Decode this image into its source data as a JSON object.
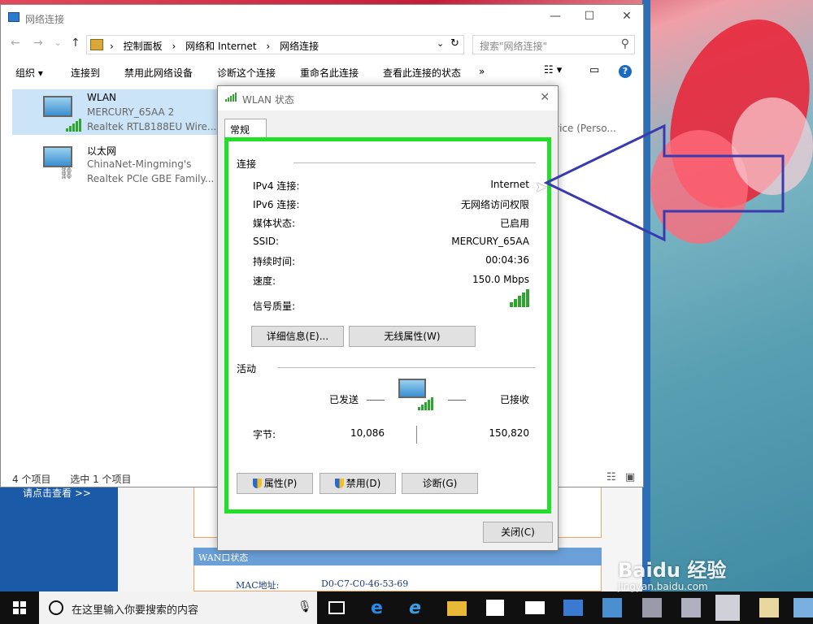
{
  "explorer": {
    "title": "网络连接",
    "breadcrumb": [
      "控制面板",
      "网络和 Internet",
      "网络连接"
    ],
    "search_placeholder": "搜索\"网络连接\"",
    "toolbar": {
      "organize": "组织 ▾",
      "connect_to": "连接到",
      "disable_device": "禁用此网络设备",
      "diagnose": "诊断这个连接",
      "rename": "重命名此连接",
      "view_status": "查看此连接的状态",
      "more": "»"
    },
    "items": [
      {
        "name": "WLAN",
        "line2": "MERCURY_65AA  2",
        "line3": "Realtek RTL8188EU Wire..."
      },
      {
        "name": "以太网",
        "line2": "ChinaNet-Mingming's",
        "line3": "Realtek PCIe GBE Family..."
      }
    ],
    "right_text": "vice (Perso...",
    "status_count": "4 个项目",
    "status_selected": "选中 1 个项目"
  },
  "dialog": {
    "title": "WLAN 状态",
    "tab": "常规",
    "connection_section": "连接",
    "rows": [
      {
        "label": "IPv4 连接:",
        "value": "Internet"
      },
      {
        "label": "IPv6 连接:",
        "value": "无网络访问权限"
      },
      {
        "label": "媒体状态:",
        "value": "已启用"
      },
      {
        "label": "SSID:",
        "value": "MERCURY_65AA"
      },
      {
        "label": "持续时间:",
        "value": "00:04:36"
      },
      {
        "label": "速度:",
        "value": "150.0 Mbps"
      }
    ],
    "signal_label": "信号质量:",
    "signal_bars": 5,
    "details_button": "详细信息(E)...",
    "wireless_props_button": "无线属性(W)",
    "activity_section": "活动",
    "sent_label": "已发送",
    "received_label": "已接收",
    "bytes_label": "字节:",
    "bytes_sent": "10,086",
    "bytes_received": "150,820",
    "properties_button": "属性(P)",
    "disable_button": "禁用(D)",
    "diagnose_button": "诊断(G)",
    "close_button": "关闭(C)"
  },
  "background_page": {
    "link_text": "请点击查看 >>",
    "wan_header": "WAN口状态",
    "mac_label": "MAC地址:",
    "mac_value": "D0-C7-C0-46-53-69"
  },
  "taskbar": {
    "search_placeholder": "在这里输入你要搜索的内容"
  },
  "watermark": {
    "brand": "Baidu 经验",
    "url": "jingyan.baidu.com"
  },
  "colors": {
    "highlight_box": "#22e02a",
    "arrow": "#3a3ab0",
    "selection": "#cce4f7"
  }
}
